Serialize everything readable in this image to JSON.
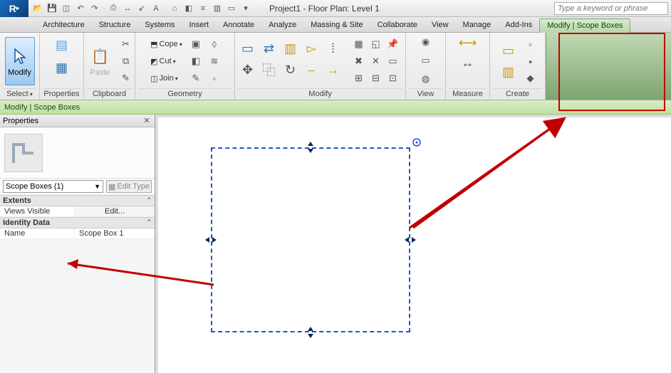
{
  "title": "Project1 - Floor Plan: Level 1",
  "search_placeholder": "Type a keyword or phrase",
  "tabs": [
    "Architecture",
    "Structure",
    "Systems",
    "Insert",
    "Annotate",
    "Analyze",
    "Massing & Site",
    "Collaborate",
    "View",
    "Manage",
    "Add-Ins",
    "Modify | Scope Boxes"
  ],
  "active_tab": "Modify | Scope Boxes",
  "ribbon": {
    "select": {
      "modify": "Modify",
      "label": "Select"
    },
    "properties": {
      "label": "Properties"
    },
    "clipboard": {
      "paste": "Paste",
      "label": "Clipboard"
    },
    "geometry": {
      "cope": "Cope",
      "cut": "Cut",
      "join": "Join",
      "label": "Geometry"
    },
    "modify": {
      "label": "Modify"
    },
    "view": {
      "label": "View"
    },
    "measure": {
      "label": "Measure"
    },
    "create": {
      "label": "Create"
    }
  },
  "subbar": "Modify | Scope Boxes",
  "properties_panel": {
    "title": "Properties",
    "type_selector": "Scope Boxes (1)",
    "edit_type": "Edit Type",
    "cat1": "Extents",
    "views_visible_k": "Views Visible",
    "views_visible_v": "Edit...",
    "cat2": "Identity Data",
    "name_k": "Name",
    "name_v": "Scope Box 1"
  }
}
